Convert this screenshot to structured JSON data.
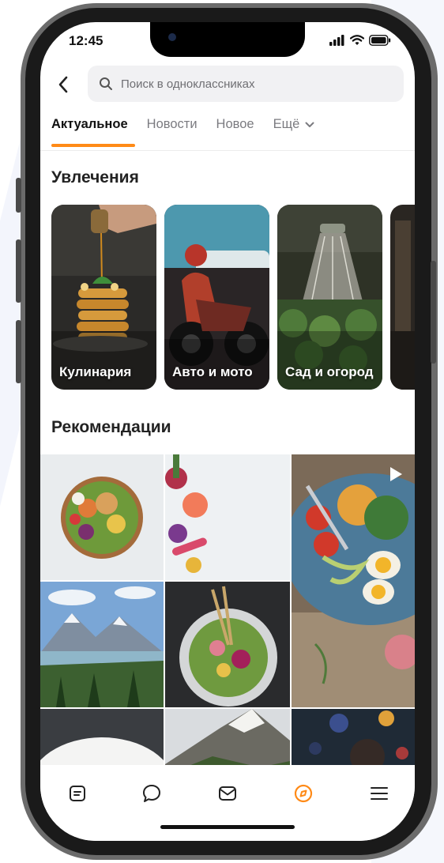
{
  "status": {
    "time": "12:45"
  },
  "search": {
    "placeholder": "Поиск в одноклассниках"
  },
  "tabs": [
    {
      "label": "Актуальное",
      "active": true
    },
    {
      "label": "Новости"
    },
    {
      "label": "Новое"
    },
    {
      "label": "Ещё"
    }
  ],
  "hobbies": {
    "title": "Увлечения",
    "items": [
      {
        "label": "Кулинария",
        "image": "pancakes-with-syrup"
      },
      {
        "label": "Авто и мото",
        "image": "motorcycle"
      },
      {
        "label": "Сад и огород",
        "image": "garden-watering"
      },
      {
        "label": "",
        "image": "partial-card"
      }
    ]
  },
  "recommendations": {
    "title": "Рекомендации",
    "tiles": [
      {
        "image": "salad-bowl"
      },
      {
        "image": "fruits-flatlay"
      },
      {
        "image": "plate-with-eggs-video",
        "video": true
      },
      {
        "image": "mountain-lake"
      },
      {
        "image": "salad-plate"
      },
      {
        "image": "white-bowl"
      },
      {
        "image": "mountain-peak"
      },
      {
        "image": "berries-dark"
      }
    ]
  },
  "bottom_nav": [
    {
      "icon": "feed-icon"
    },
    {
      "icon": "discussions-icon"
    },
    {
      "icon": "messages-icon"
    },
    {
      "icon": "explore-icon",
      "active": true
    },
    {
      "icon": "menu-icon"
    }
  ],
  "colors": {
    "accent": "#ff8a17",
    "text": "#222222",
    "muted": "#7b7b80",
    "search_bg": "#f1f1f3"
  }
}
